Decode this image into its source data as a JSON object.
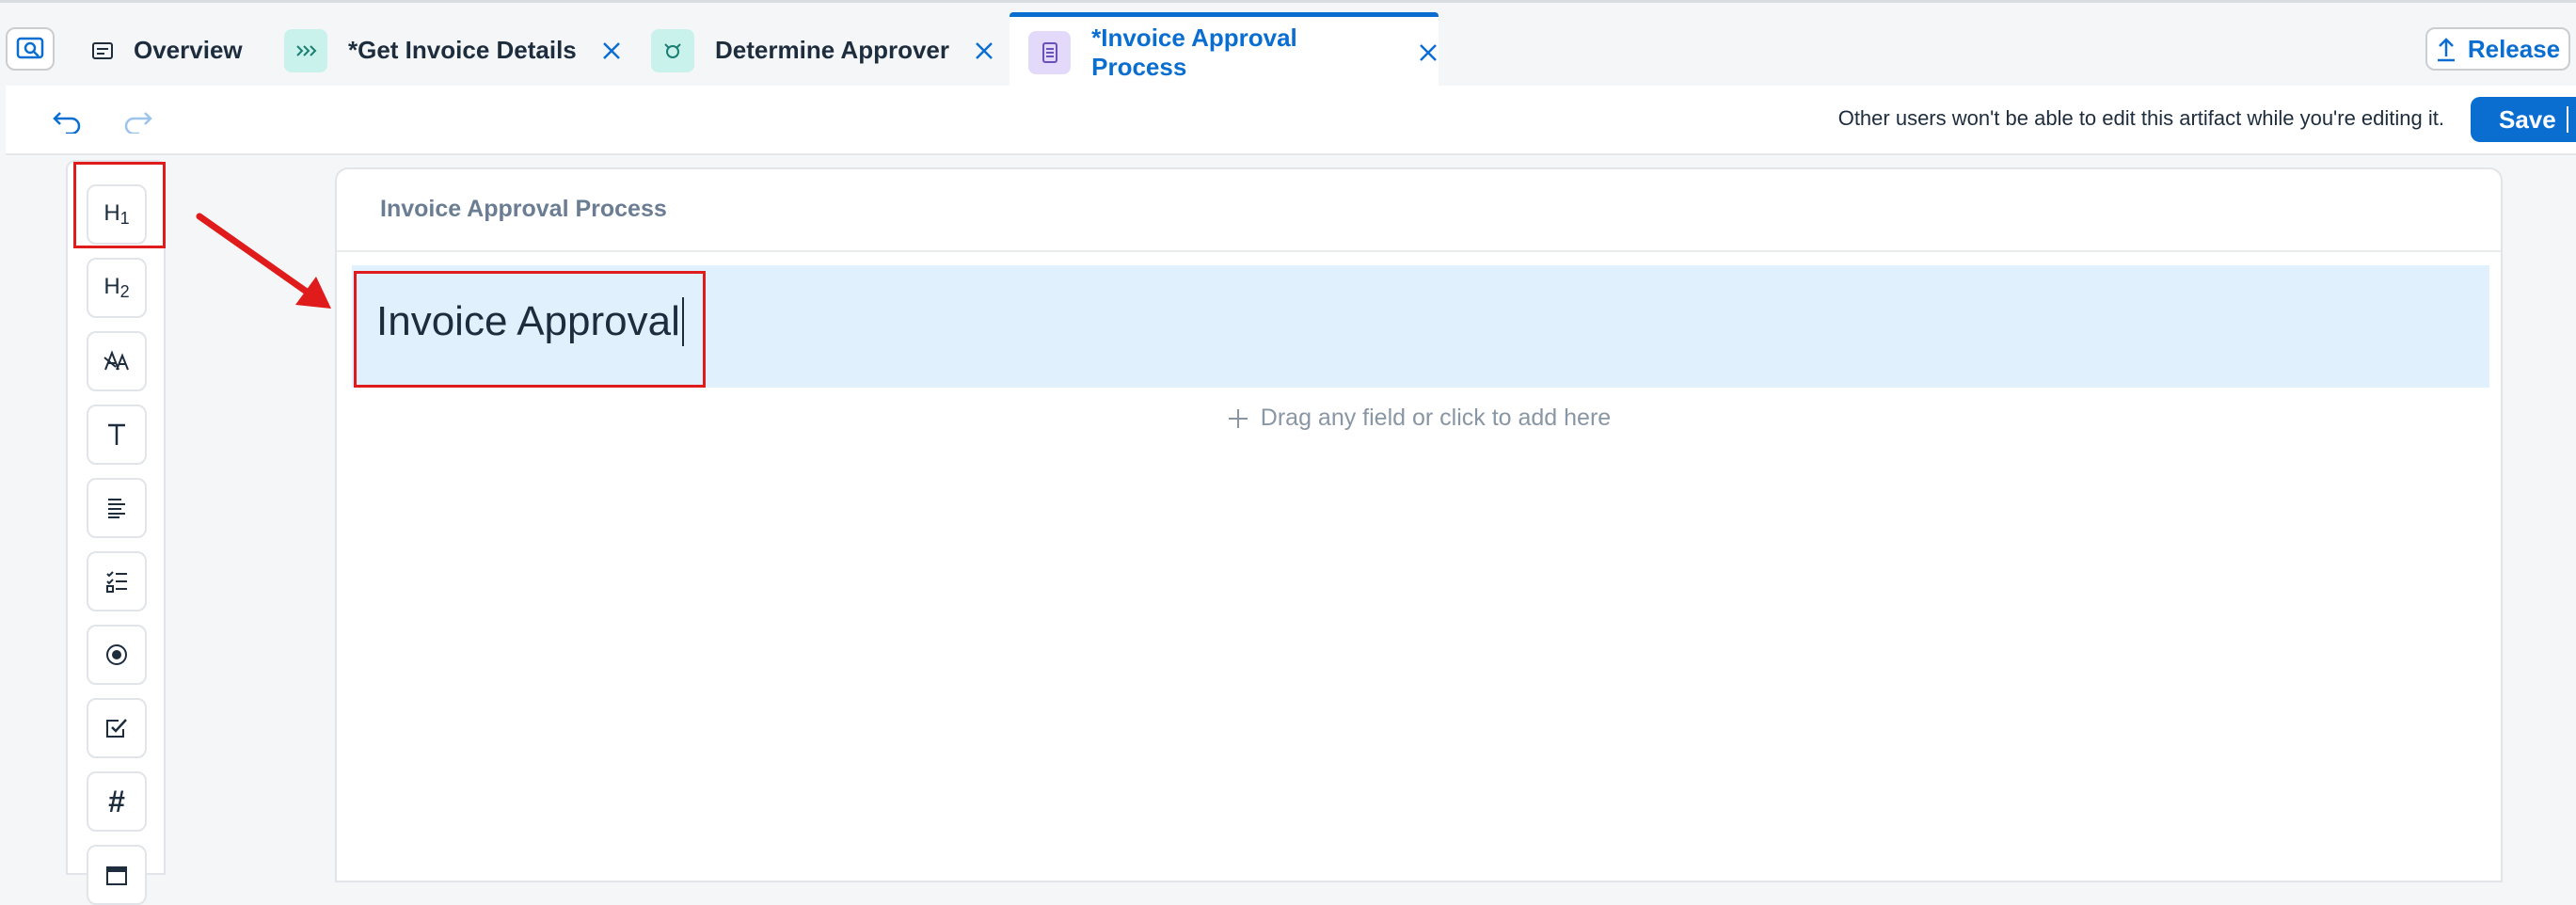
{
  "tabs": [
    {
      "label": "Overview",
      "icon": "overview-icon"
    },
    {
      "label": "*Get Invoice Details",
      "icon": "step-chevrons-icon"
    },
    {
      "label": "Determine Approver",
      "icon": "decision-icon"
    },
    {
      "label": "*Invoice Approval Process",
      "icon": "form-icon",
      "active": true
    }
  ],
  "header": {
    "release_label": "Release"
  },
  "toolbar": {
    "edit_note": "Other users won't be able to edit this artifact while you're editing it.",
    "save_label": "Save"
  },
  "palette": {
    "items": [
      {
        "name": "heading-1",
        "label": "H",
        "sub": "1"
      },
      {
        "name": "heading-2",
        "label": "H",
        "sub": "2"
      },
      {
        "name": "paragraph-style",
        "label": "ᴬ"
      },
      {
        "name": "text-input",
        "label": "T"
      },
      {
        "name": "paragraph",
        "label": "≡"
      },
      {
        "name": "checklist",
        "label": "☰"
      },
      {
        "name": "radio",
        "label": "◉"
      },
      {
        "name": "checkbox",
        "label": "☑"
      },
      {
        "name": "number",
        "label": "#"
      },
      {
        "name": "date",
        "label": "▦"
      }
    ]
  },
  "canvas": {
    "title": "Invoice Approval Process",
    "heading_value": "Invoice Approval",
    "drop_hint": "Drag any field or click to add here"
  },
  "colors": {
    "accent": "#0a6ed1",
    "annotation": "#e01b1b",
    "selected_row": "#e0f1fd"
  }
}
